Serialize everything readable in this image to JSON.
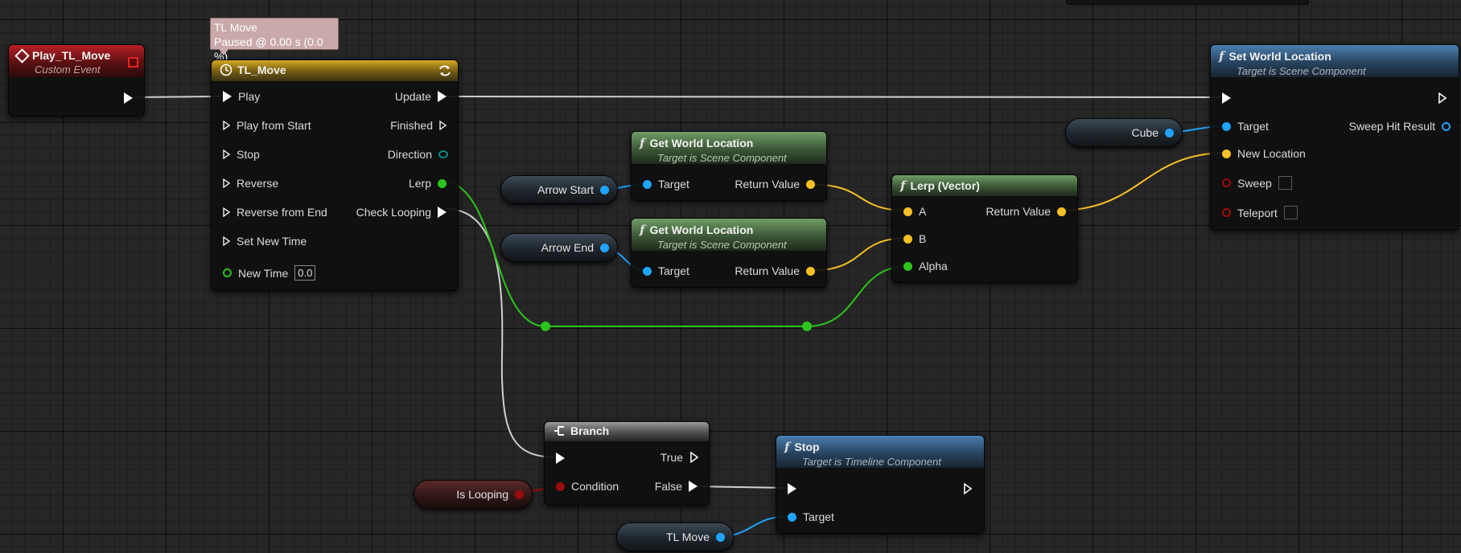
{
  "tooltip": {
    "line1": "TL Move",
    "line2": "Paused @ 0.00 s (0.0 %)"
  },
  "event_node": {
    "title": "Play_TL_Move",
    "subtitle": "Custom Event"
  },
  "timeline_node": {
    "title": "TL_Move",
    "inputs": [
      "Play",
      "Play from Start",
      "Stop",
      "Reverse",
      "Reverse from End",
      "Set New Time"
    ],
    "new_time_label": "New Time",
    "new_time_value": "0.0",
    "outputs": [
      "Update",
      "Finished",
      "Direction",
      "Lerp",
      "Check Looping"
    ]
  },
  "get_world_location_1": {
    "title": "Get World Location",
    "subtitle": "Target is Scene Component",
    "in": "Target",
    "out": "Return Value"
  },
  "get_world_location_2": {
    "title": "Get World Location",
    "subtitle": "Target is Scene Component",
    "in": "Target",
    "out": "Return Value"
  },
  "lerp_node": {
    "title": "Lerp (Vector)",
    "a": "A",
    "b": "B",
    "alpha": "Alpha",
    "out": "Return Value"
  },
  "set_world_location": {
    "title": "Set World Location",
    "subtitle": "Target is Scene Component",
    "target": "Target",
    "new_location": "New Location",
    "sweep": "Sweep",
    "teleport": "Teleport",
    "sweep_hit": "Sweep Hit Result"
  },
  "branch_node": {
    "title": "Branch",
    "condition": "Condition",
    "true_label": "True",
    "false_label": "False"
  },
  "stop_node": {
    "title": "Stop",
    "subtitle": "Target is Timeline Component",
    "target": "Target"
  },
  "variables": {
    "arrow_start": "Arrow Start",
    "arrow_end": "Arrow End",
    "cube": "Cube",
    "is_looping": "Is Looping",
    "tl_move": "TL Move"
  },
  "colors": {
    "exec": "#ffffff",
    "object": "#1fa4ff",
    "vector": "#f7c024",
    "float": "#2bc41c",
    "bool": "#9a0b0b",
    "wire_exec": "#d0d0d0"
  }
}
